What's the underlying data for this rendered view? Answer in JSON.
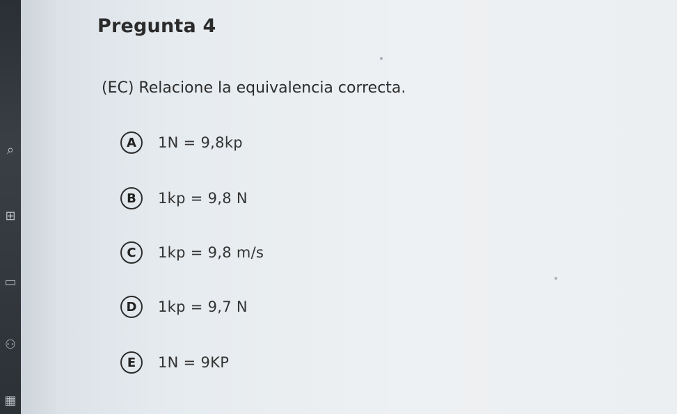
{
  "question": {
    "title": "Pregunta 4",
    "prompt": "(EC) Relacione la equivalencia correcta."
  },
  "options": [
    {
      "letter": "A",
      "text": "1N = 9,8kp"
    },
    {
      "letter": "B",
      "text": "1kp = 9,8 N"
    },
    {
      "letter": "C",
      "text": "1kp = 9,8 m/s"
    },
    {
      "letter": "D",
      "text": "1kp = 9,7 N"
    },
    {
      "letter": "E",
      "text": "1N = 9KP"
    }
  ],
  "rail_icons": [
    "search-icon",
    "grid-icon",
    "book-icon",
    "people-icon",
    "calendar-icon"
  ]
}
